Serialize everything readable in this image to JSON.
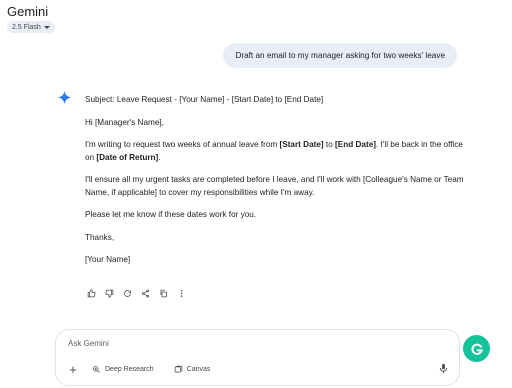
{
  "header": {
    "title": "Gemini",
    "model": "2.5 Flash"
  },
  "user_message": "Draft an email to my manager asking for two weeks' leave",
  "response": {
    "subject": "Subject: Leave Request - [Your Name] - [Start Date] to [End Date]",
    "greeting": "Hi [Manager's Name],",
    "para1_a": "I'm writing to request two weeks of annual leave from ",
    "para1_b": "[Start Date]",
    "para1_c": " to ",
    "para1_d": "[End Date]",
    "para1_e": ". I'll be back in the office on ",
    "para1_f": "[Date of Return]",
    "para1_g": ".",
    "para2": "I'll ensure all my urgent tasks are completed before I leave, and I'll work with [Colleague's Name or Team Name, if applicable] to cover my responsibilities while I'm away.",
    "para3": "Please let me know if these dates work for you.",
    "closing": "Thanks,",
    "signature": "[Your Name]"
  },
  "actions": [
    "thumbs-up-icon",
    "thumbs-down-icon",
    "regenerate-icon",
    "share-icon",
    "copy-icon",
    "more-icon"
  ],
  "input": {
    "placeholder": "Ask Gemini",
    "tools": {
      "deep_research": "Deep Research",
      "canvas": "Canvas"
    }
  },
  "colors": {
    "accent": "#4285f4",
    "bubble": "#e9eef6",
    "grammarly": "#15c39a"
  }
}
